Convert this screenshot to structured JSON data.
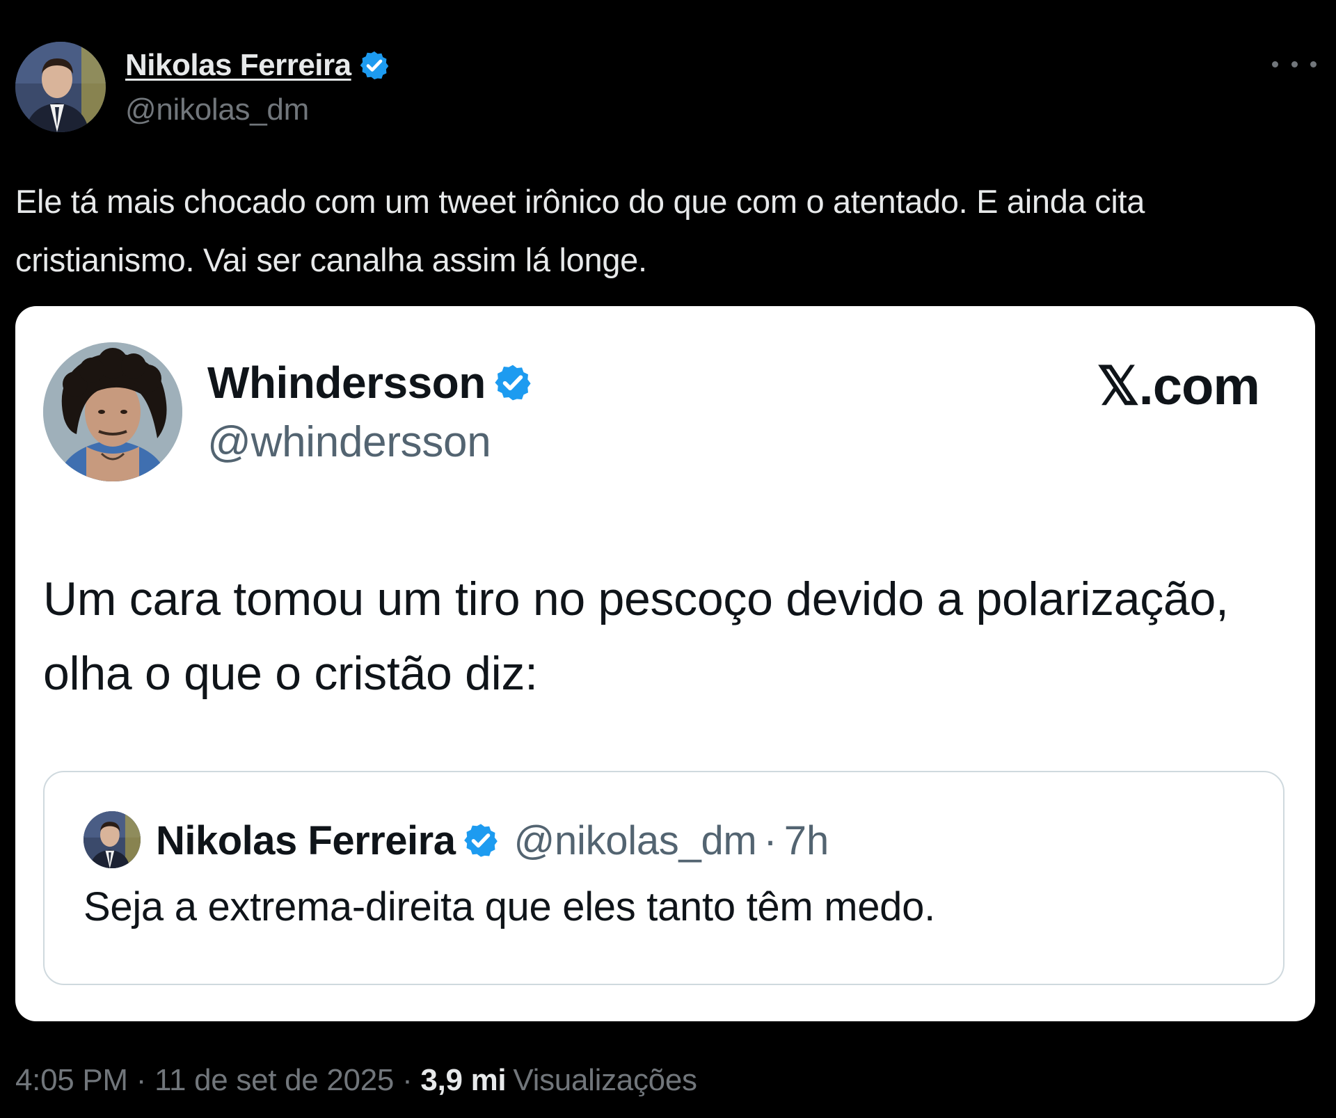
{
  "colors": {
    "background": "#000000",
    "primary_text": "#e7e9ea",
    "secondary_text": "#71767b",
    "card_background": "#ffffff",
    "card_text": "#0f1419",
    "card_secondary_text": "#536471",
    "verified_badge": "#1d9bf0"
  },
  "tweet": {
    "author": {
      "name": "Nikolas Ferreira",
      "handle": "@nikolas_dm",
      "verified": true,
      "avatar_icon": "avatar-photo"
    },
    "more_icon": "more-horizontal-icon",
    "text": "Ele tá mais chocado com um tweet irônico do que com o atentado. E ainda cita cristianismo. Vai ser canalha assim lá longe.",
    "time": "4:05 PM",
    "separator": "·",
    "date": "11 de set de 2025",
    "views_count": "3,9 mi",
    "views_label": "Visualizações"
  },
  "embedded_card": {
    "author": {
      "name": "Whindersson",
      "handle": "@whindersson",
      "verified": true,
      "avatar_icon": "avatar-photo"
    },
    "site_label": "𝕏.com",
    "text": "Um cara tomou um tiro no pescoço devido a polarização, olha o que o cristão diz:",
    "quoted_tweet": {
      "author": {
        "name": "Nikolas Ferreira",
        "handle": "@nikolas_dm",
        "verified": true,
        "avatar_icon": "avatar-photo"
      },
      "separator": "·",
      "time": "7h",
      "text": "Seja a extrema-direita que eles tanto têm medo."
    }
  }
}
